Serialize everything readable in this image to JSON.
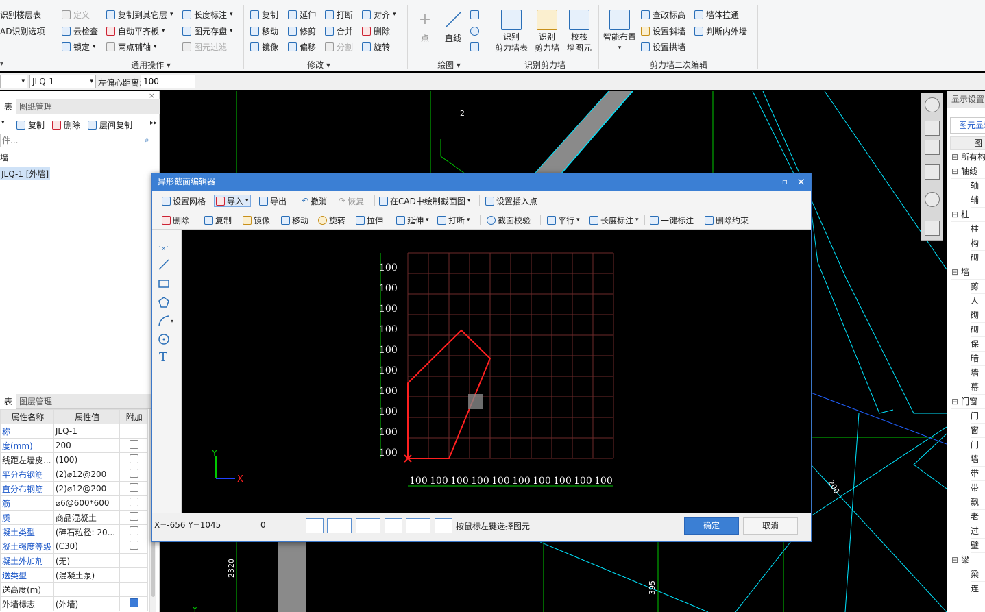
{
  "ribbon": {
    "col1": [
      "识别楼层表",
      "AD识别选项"
    ],
    "col2": [
      "定义",
      "云检查",
      "锁定"
    ],
    "col3": [
      "复制到其它层",
      "自动平齐板",
      "两点辅轴"
    ],
    "col4": [
      "长度标注",
      "图元存盘",
      "图元过滤"
    ],
    "edit_col1": [
      "复制",
      "移动",
      "镜像"
    ],
    "edit_col2": [
      "延伸",
      "修剪",
      "偏移"
    ],
    "edit_col3": [
      "打断",
      "合并",
      "分割"
    ],
    "edit_col4": [
      "对齐",
      "删除",
      "旋转"
    ],
    "draw_point": "点",
    "draw_line": "直线",
    "big_shear_table": "识别\n剪力墙表",
    "big_shear_wall": "识别\n剪力墙",
    "big_check": "校核\n墙图元",
    "big_smart": "智能布置",
    "wall2_col1": [
      "查改标高",
      "设置斜墙",
      "设置拱墙"
    ],
    "wall2_col2": [
      "墙体拉通",
      "判断内外墙"
    ],
    "groups": {
      "general": "通用操作",
      "modify": "修改",
      "draw": "绘图",
      "identify": "识别剪力墙",
      "secondary": "剪力墙二次编辑"
    }
  },
  "bar2": {
    "select1": "",
    "select2": "JLQ-1",
    "offset_label": "左偏心距离:",
    "offset_value": "100"
  },
  "left": {
    "tabs1": [
      "表",
      "图纸管理"
    ],
    "toolbar": [
      "复制",
      "删除",
      "层间复制"
    ],
    "search_placeholder": "件...",
    "tree_root": "墙",
    "tree_item": "JLQ-1 [外墙]",
    "tabs2": [
      "表",
      "图层管理"
    ],
    "prop_headers": [
      "属性名称",
      "属性值",
      "附加"
    ],
    "props": [
      {
        "name": "称",
        "value": "JLQ-1",
        "check": null,
        "link": true
      },
      {
        "name": "度(mm)",
        "value": "200",
        "check": false,
        "link": true
      },
      {
        "name": "线距左墙皮...",
        "value": "(100)",
        "check": false,
        "link": false
      },
      {
        "name": "平分布钢筋",
        "value": "(2)⌀12@200",
        "check": false,
        "link": true
      },
      {
        "name": "直分布钢筋",
        "value": "(2)⌀12@200",
        "check": false,
        "link": true
      },
      {
        "name": "筋",
        "value": "⌀6@600*600",
        "check": false,
        "link": true
      },
      {
        "name": "质",
        "value": "商品混凝土",
        "check": false,
        "link": true
      },
      {
        "name": "凝土类型",
        "value": "(碎石粒径: 20...",
        "check": false,
        "link": true
      },
      {
        "name": "凝土强度等级",
        "value": "(C30)",
        "check": false,
        "link": true
      },
      {
        "name": "凝土外加剂",
        "value": "(无)",
        "check": null,
        "link": true
      },
      {
        "name": "送类型",
        "value": "(混凝土泵)",
        "check": null,
        "link": true
      },
      {
        "name": "送高度(m)",
        "value": "",
        "check": null,
        "link": false
      },
      {
        "name": "外墙标志",
        "value": "(外墙)",
        "check": true,
        "link": false
      }
    ]
  },
  "right": {
    "header": "显示设置",
    "subtab": "图元显示",
    "col_header": "图",
    "items": [
      "所有构",
      "轴线",
      "轴",
      "辅",
      "柱",
      "柱",
      "构",
      "砌",
      "墙",
      "剪",
      "人",
      "砌",
      "砌",
      "保",
      "暗",
      "墙",
      "幕",
      "门窗",
      "门",
      "窗",
      "门",
      "墙",
      "带",
      "带",
      "飘",
      "老",
      "过",
      "壁",
      "梁",
      "梁",
      "连"
    ]
  },
  "dialog": {
    "title": "异形截面编辑器",
    "toolbar1": [
      "设置网格",
      "导入",
      "导出",
      "撤消",
      "恢复",
      "在CAD中绘制截面图",
      "设置插入点"
    ],
    "toolbar2": [
      "删除",
      "复制",
      "镜像",
      "移动",
      "旋转",
      "拉伸",
      "延伸",
      "打断",
      "截面校验",
      "平行",
      "长度标注",
      "一键标注",
      "删除约束"
    ],
    "y_labels": [
      "100",
      "100",
      "100",
      "100",
      "100",
      "100",
      "100",
      "100",
      "100",
      "100"
    ],
    "x_labels": [
      "100",
      "100",
      "100",
      "100",
      "100",
      "100",
      "100",
      "100",
      "100",
      "100"
    ],
    "axis_y": "Y",
    "axis_x": "X",
    "coords": "X=-656 Y=1045",
    "coord_extra": "0",
    "hint": "按鼠标左键选择图元",
    "ok": "确定",
    "cancel": "取消"
  },
  "cad": {
    "label_2": "2",
    "label_200": "200",
    "label_2320": "2320",
    "label_395": "395",
    "label_y": "Y"
  },
  "colors": {
    "accent": "#3b7fd4",
    "grid": "#6e2a2a",
    "shape": "#ff2020",
    "cad_cyan": "#00e5ff",
    "cad_green": "#00c800"
  }
}
